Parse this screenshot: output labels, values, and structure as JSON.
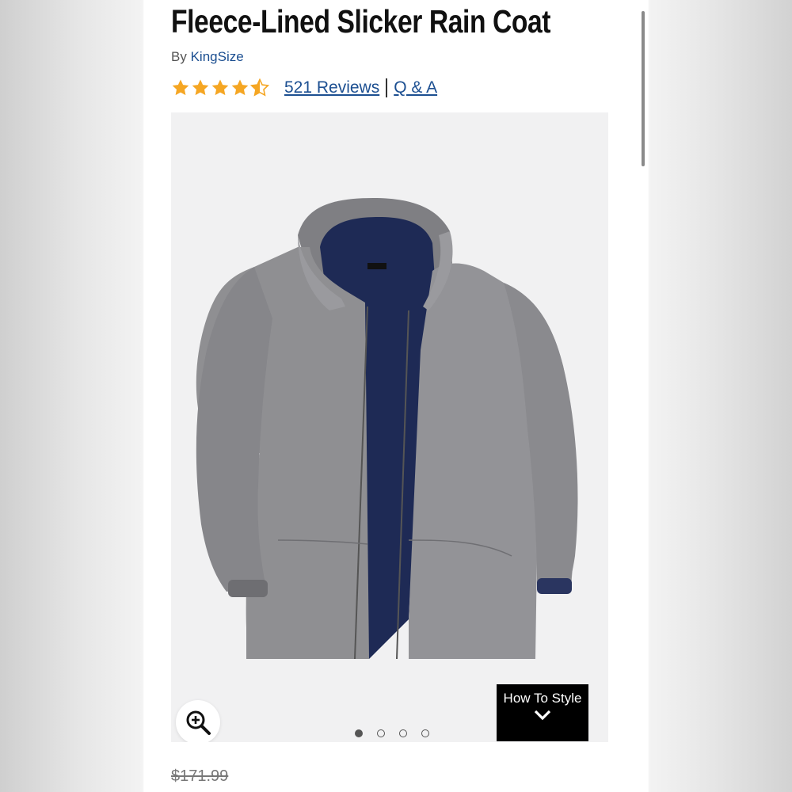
{
  "product": {
    "title": "Fleece-Lined Slicker Rain Coat",
    "by_prefix": "By",
    "brand": "KingSize",
    "rating": 4.5,
    "reviews_label": "521 Reviews",
    "qa_label": "Q & A",
    "star_color": "#f5a623"
  },
  "gallery": {
    "how_to_style_label": "How To Style",
    "image_count": 4,
    "active_index": 0
  },
  "price": {
    "original": "$171.99"
  },
  "colors": {
    "link": "#1c4f91",
    "jacket_shell": "#8f8f92",
    "jacket_lining": "#1e2a55"
  }
}
